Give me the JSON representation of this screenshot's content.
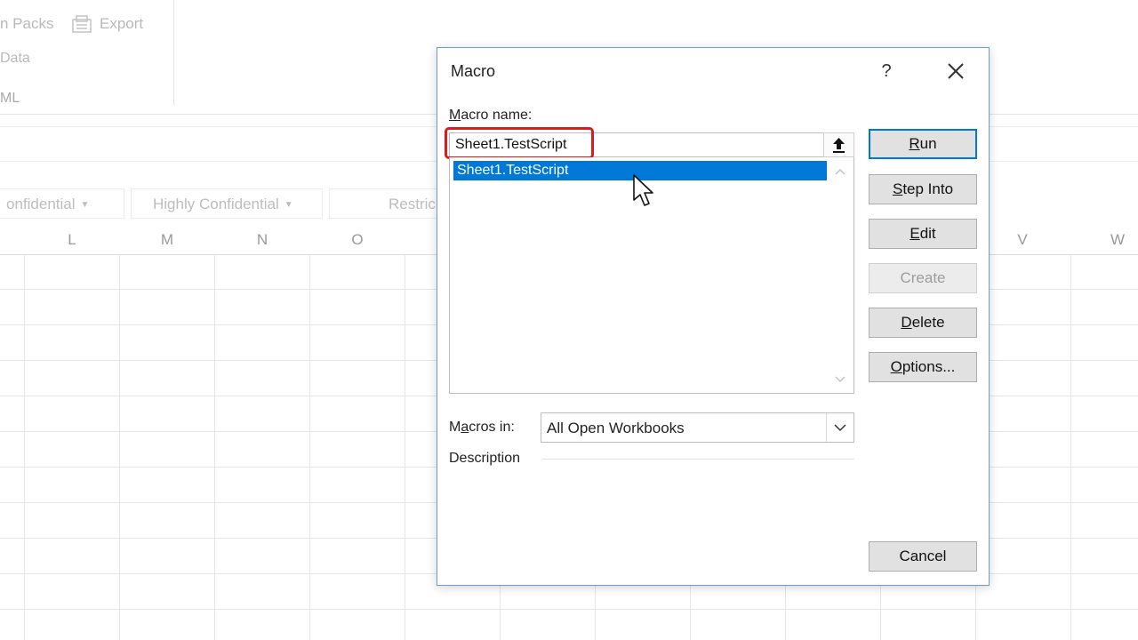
{
  "ribbon": {
    "packs_label": "n Packs",
    "export_label": "Export",
    "data_label": "Data",
    "xml_label": "ML"
  },
  "sensitivity": {
    "confidential": "onfidential",
    "highly_confidential": "Highly Confidential",
    "restricted": "Restric"
  },
  "columns": [
    "L",
    "M",
    "N",
    "O",
    "V",
    "W"
  ],
  "dialog": {
    "title": "Macro",
    "help": "?",
    "macro_name_label_accel": "M",
    "macro_name_label_rest": "acro name:",
    "macro_name_value": "Sheet1.TestScript",
    "list_items": [
      "Sheet1.TestScript"
    ],
    "buttons": {
      "run_accel": "R",
      "run_rest": "un",
      "step_into_accel": "S",
      "step_into_rest": "tep Into",
      "edit_accel": "E",
      "edit_rest": "dit",
      "create": "Create",
      "delete_accel": "D",
      "delete_rest": "elete",
      "options_accel": "O",
      "options_rest": "ptions...",
      "cancel": "Cancel"
    },
    "macros_in_label_pre": "M",
    "macros_in_label_accel": "a",
    "macros_in_label_rest": "cros in:",
    "macros_in_value": "All Open Workbooks",
    "description_label": "Description"
  },
  "colors": {
    "accent": "#0078d7",
    "highlight": "#d41f1f",
    "dialog_border": "#6b9bd1"
  }
}
